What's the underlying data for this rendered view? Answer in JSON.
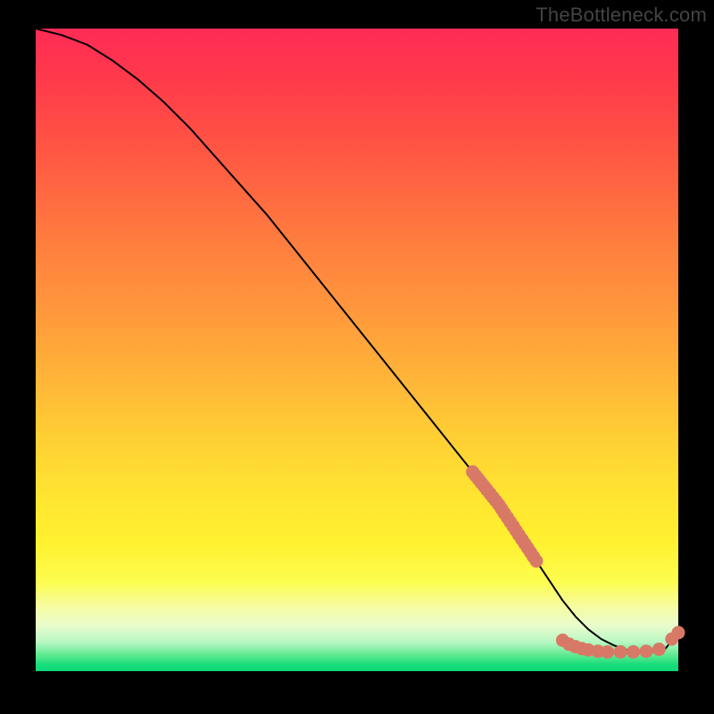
{
  "watermark": "TheBottleneck.com",
  "chart_data": {
    "type": "line",
    "title": "",
    "xlabel": "",
    "ylabel": "",
    "xlim": [
      0,
      100
    ],
    "ylim": [
      0,
      100
    ],
    "grid": false,
    "legend": false,
    "series": [
      {
        "name": "curve",
        "x": [
          0,
          4,
          8,
          12,
          16,
          20,
          24,
          28,
          32,
          36,
          40,
          44,
          48,
          52,
          56,
          60,
          64,
          68,
          70,
          72,
          74,
          76,
          78,
          80,
          82,
          84,
          86,
          88,
          90,
          92,
          94,
          96,
          98,
          100
        ],
        "y": [
          100,
          99,
          97.5,
          95,
          92,
          88.5,
          84.5,
          80,
          75.5,
          71,
          66,
          61,
          56,
          51,
          46,
          41,
          36,
          31,
          28.5,
          26,
          23,
          20,
          17,
          14,
          11,
          8.5,
          6.5,
          5,
          4,
          3.3,
          3,
          3,
          3.5,
          6
        ]
      }
    ],
    "markers": [
      {
        "name": "segment-upper",
        "x_range": [
          68,
          78
        ],
        "y_range": [
          31,
          17
        ],
        "color": "#d87967"
      },
      {
        "name": "cluster-valley",
        "points": [
          {
            "x": 82,
            "y": 4.8
          },
          {
            "x": 83,
            "y": 4.2
          },
          {
            "x": 84,
            "y": 3.8
          },
          {
            "x": 85,
            "y": 3.5
          },
          {
            "x": 86,
            "y": 3.3
          },
          {
            "x": 87.5,
            "y": 3.1
          },
          {
            "x": 89,
            "y": 3.0
          },
          {
            "x": 91,
            "y": 3.0
          },
          {
            "x": 93,
            "y": 3.0
          },
          {
            "x": 95,
            "y": 3.1
          },
          {
            "x": 97,
            "y": 3.4
          }
        ],
        "color": "#d87967"
      },
      {
        "name": "point-end",
        "points": [
          {
            "x": 99,
            "y": 5.0
          },
          {
            "x": 100,
            "y": 6.0
          }
        ],
        "color": "#d87967"
      }
    ],
    "colors": {
      "curve": "#000000",
      "marker": "#d87967",
      "background_top": "#ff2b55",
      "background_bottom": "#0fd777"
    }
  }
}
